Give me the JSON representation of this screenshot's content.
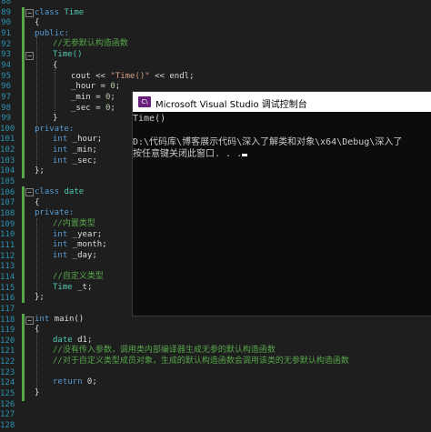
{
  "editor": {
    "line_numbers": [
      "88",
      "89",
      "90",
      "91",
      "92",
      "93",
      "94",
      "95",
      "96",
      "97",
      "98",
      "99",
      "100",
      "101",
      "102",
      "103",
      "104",
      "105",
      "106",
      "107",
      "108",
      "109",
      "110",
      "111",
      "112",
      "113",
      "114",
      "115",
      "116",
      "117",
      "118",
      "119",
      "120",
      "121",
      "122",
      "123",
      "124",
      "125",
      "126",
      "127",
      "128"
    ],
    "code": {
      "l0": "",
      "l1a": "class",
      "l1b": "Time",
      "l2": "{",
      "l3": "public:",
      "l4": "//无参默认构造函数",
      "l5": "Time()",
      "l6": "{",
      "l7a": "cout << ",
      "l7b": "\"Time()\"",
      "l7c": " << endl;",
      "l8a": "_hour = ",
      "l8b": "0",
      "l8c": ";",
      "l9a": "_min = ",
      "l9b": "0",
      "l9c": ";",
      "l10a": "_sec = ",
      "l10b": "0",
      "l10c": ";",
      "l11": "}",
      "l12": "private:",
      "l13a": "int",
      "l13b": " _hour;",
      "l14a": "int",
      "l14b": " _min;",
      "l15a": "int",
      "l15b": " _sec;",
      "l16": "};",
      "l17": "",
      "l18a": "class",
      "l18b": "date",
      "l19": "{",
      "l20": "private:",
      "l21": "//内置类型",
      "l22a": "int",
      "l22b": " _year;",
      "l23a": "int",
      "l23b": " _month;",
      "l24a": "int",
      "l24b": " _day;",
      "l25": "",
      "l26": "//自定义类型",
      "l27a": "Time",
      "l27b": " _t;",
      "l28": "};",
      "l29": "",
      "l30a": "int",
      "l30b": " main()",
      "l31": "{",
      "l32a": "date",
      "l32b": " d1;",
      "l33": "//没有传入参数，调用类内部编译器生成无参的默认构造函数",
      "l34": "//对于自定义类型成员对象，生成的默认构造函数会调用该类的无参默认构造函数",
      "l35": "",
      "l36a": "return",
      "l36b": " 0;",
      "l37": "}"
    }
  },
  "console": {
    "title": "Microsoft Visual Studio 调试控制台",
    "icon": "visual-studio-icon",
    "line1": "Time()",
    "line2": "",
    "line3": "D:\\代码库\\博客展示代码\\深入了解类和对象\\x64\\Debug\\深入了",
    "line4": "按任意键关闭此窗口. . ."
  },
  "colors": {
    "keyword": "#569cd6",
    "type": "#4ec9b0",
    "comment": "#57a64a",
    "string": "#d69d85",
    "line_number": "#2b91af",
    "console_bg": "#0c0c0c"
  }
}
